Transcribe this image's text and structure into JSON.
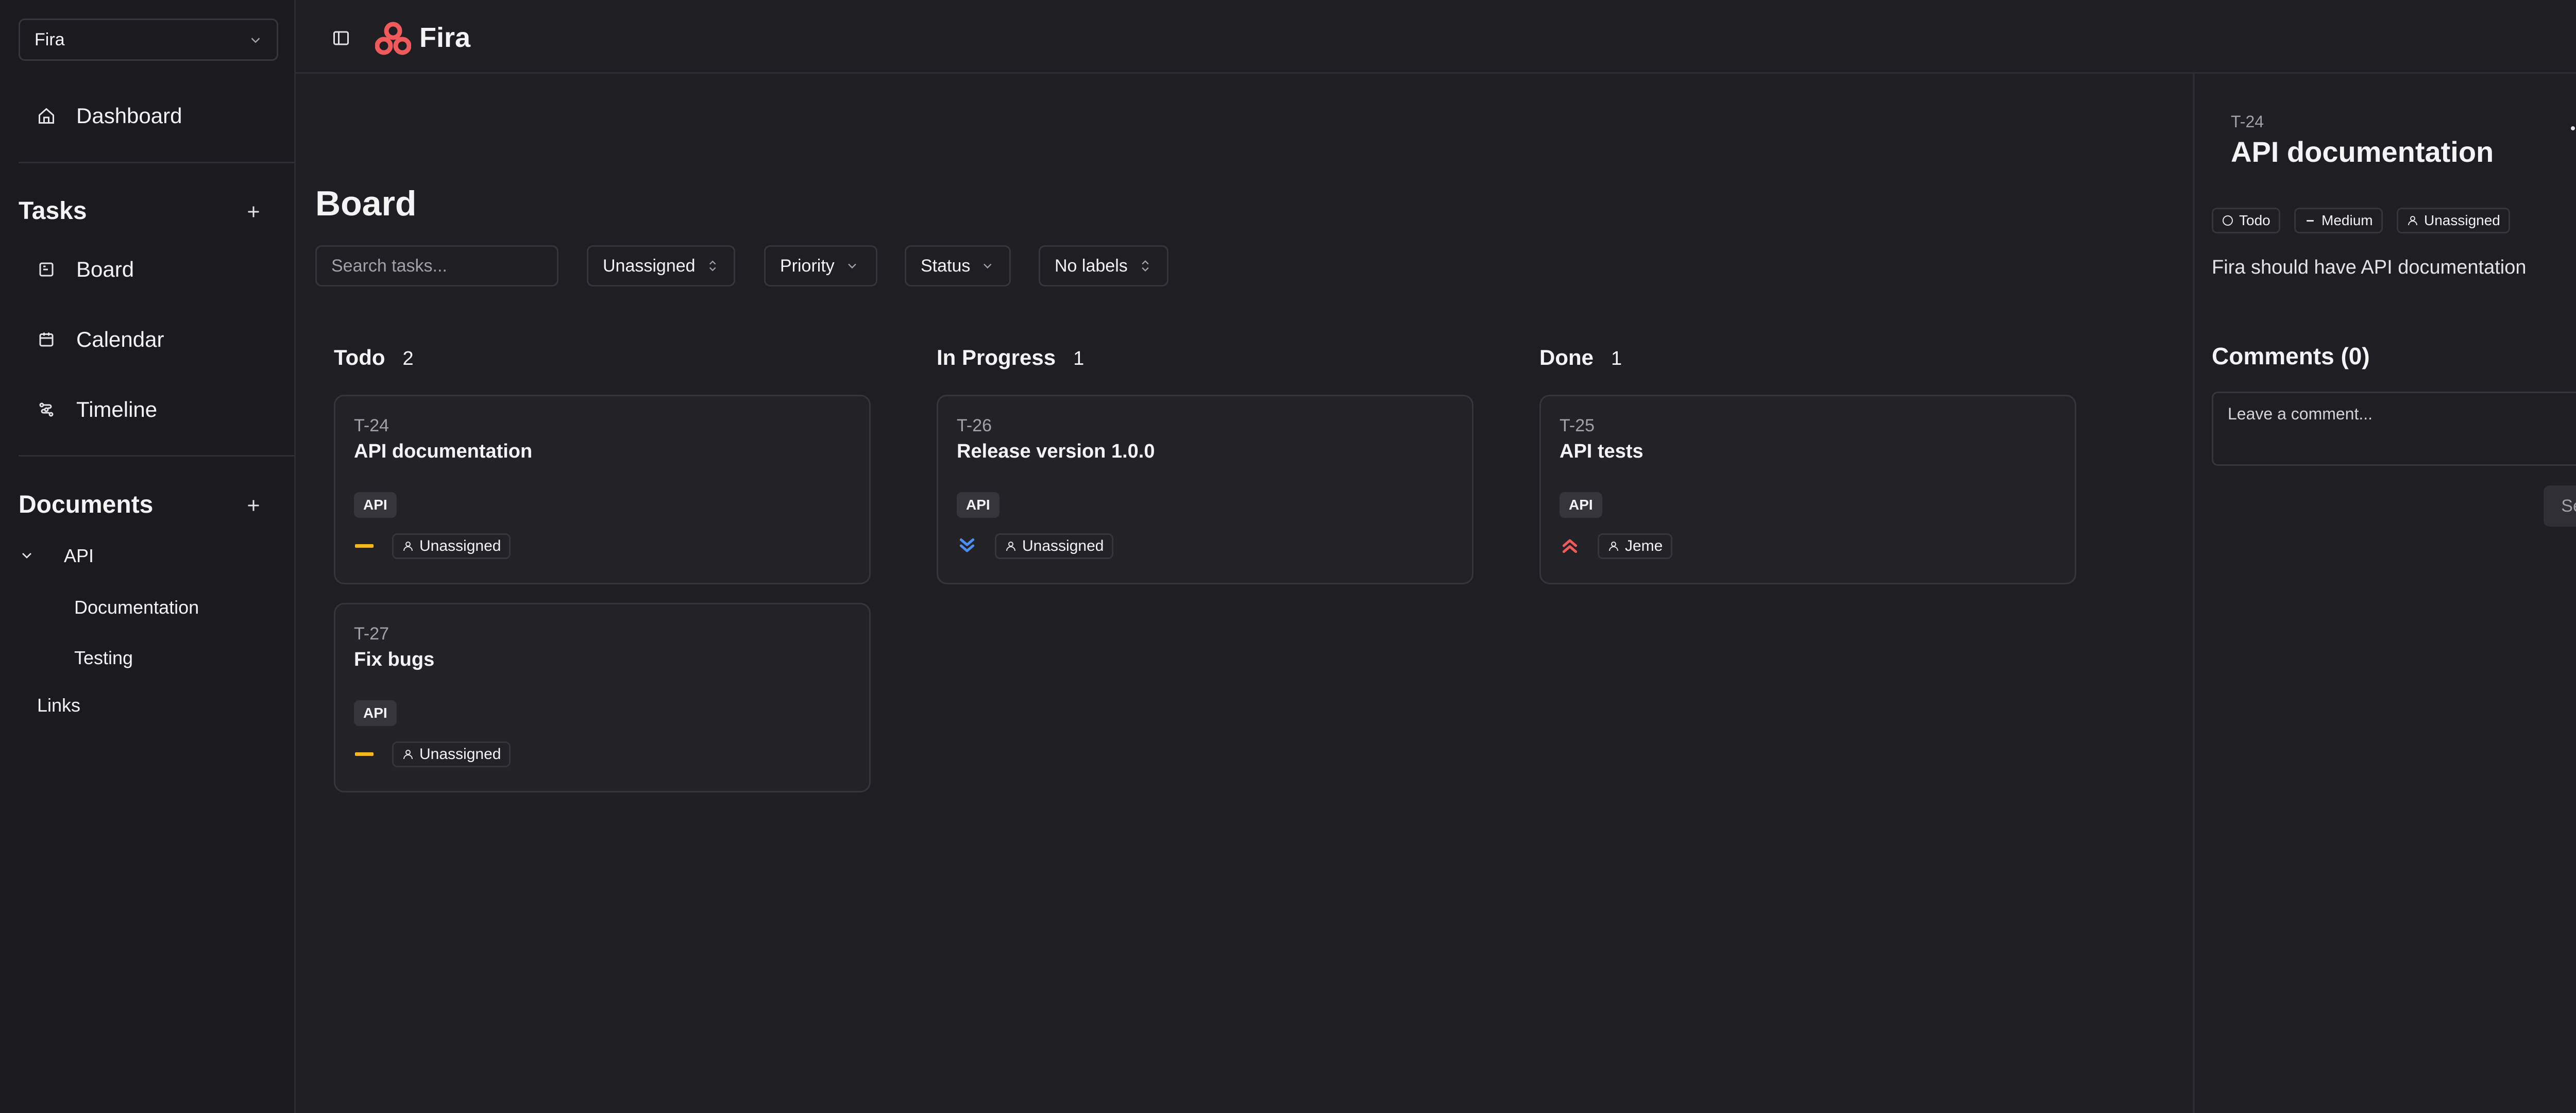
{
  "app": {
    "name": "Fira"
  },
  "workspace_select": {
    "value": "Fira"
  },
  "sidebar": {
    "dashboard_label": "Dashboard",
    "tasks_heading": "Tasks",
    "task_items": [
      {
        "label": "Board",
        "icon": "board-icon"
      },
      {
        "label": "Calendar",
        "icon": "calendar-icon"
      },
      {
        "label": "Timeline",
        "icon": "timeline-icon"
      }
    ],
    "documents_heading": "Documents",
    "documents": {
      "folder": "API",
      "children": [
        "Documentation",
        "Testing"
      ],
      "links": "Links"
    }
  },
  "board": {
    "title": "Board",
    "search_placeholder": "Search tasks...",
    "filters": {
      "assignee": "Unassigned",
      "priority": "Priority",
      "status": "Status",
      "labels": "No labels"
    },
    "columns": [
      {
        "title": "Todo",
        "count": "2",
        "cards": [
          {
            "id": "T-24",
            "title": "API documentation",
            "label": "API",
            "priority": "medium",
            "assignee": "Unassigned"
          },
          {
            "id": "T-27",
            "title": "Fix bugs",
            "label": "API",
            "priority": "medium",
            "assignee": "Unassigned"
          }
        ]
      },
      {
        "title": "In Progress",
        "count": "1",
        "cards": [
          {
            "id": "T-26",
            "title": "Release version 1.0.0",
            "label": "API",
            "priority": "low",
            "assignee": "Unassigned"
          }
        ]
      },
      {
        "title": "Done",
        "count": "1",
        "cards": [
          {
            "id": "T-25",
            "title": "API tests",
            "label": "API",
            "priority": "high",
            "assignee": "Jeme"
          }
        ]
      }
    ]
  },
  "detail": {
    "id": "T-24",
    "title": "API documentation",
    "status": "Todo",
    "priority": "Medium",
    "assignee": "Unassigned",
    "description": "Fira should have API documentation",
    "comments_heading": "Comments (0)",
    "comment_placeholder": "Leave a comment...",
    "send_label": "Send"
  },
  "colors": {
    "brand": "#ef5a5a",
    "priority_medium": "#f5b820",
    "priority_low": "#4c8ff0",
    "priority_high": "#ef5a5a"
  }
}
